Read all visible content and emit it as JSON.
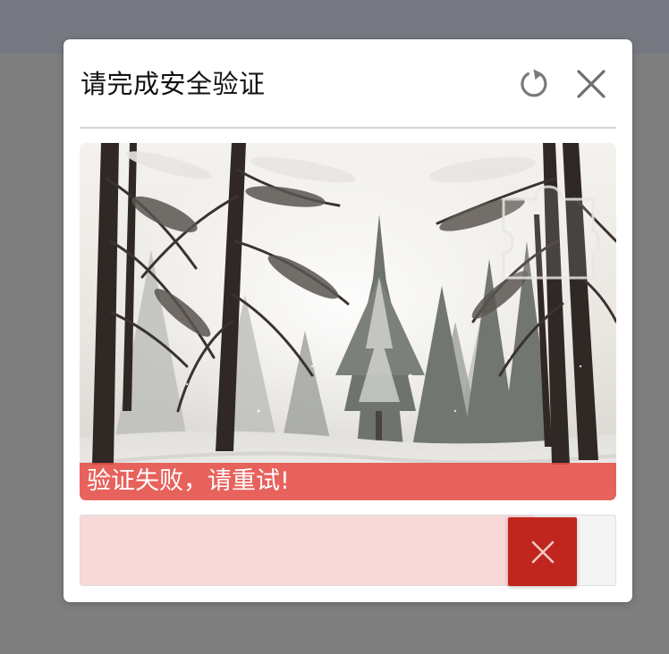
{
  "dialog": {
    "title": "请完成安全验证",
    "refresh_icon": "refresh-icon",
    "close_icon": "close-icon"
  },
  "captcha": {
    "status_message": "验证失败，请重试!",
    "status_color": "#e64e48",
    "slider_progress": 0.85,
    "handle_icon": "cross-icon",
    "handle_color": "#c0261e",
    "fill_color": "#f8d8d8"
  }
}
